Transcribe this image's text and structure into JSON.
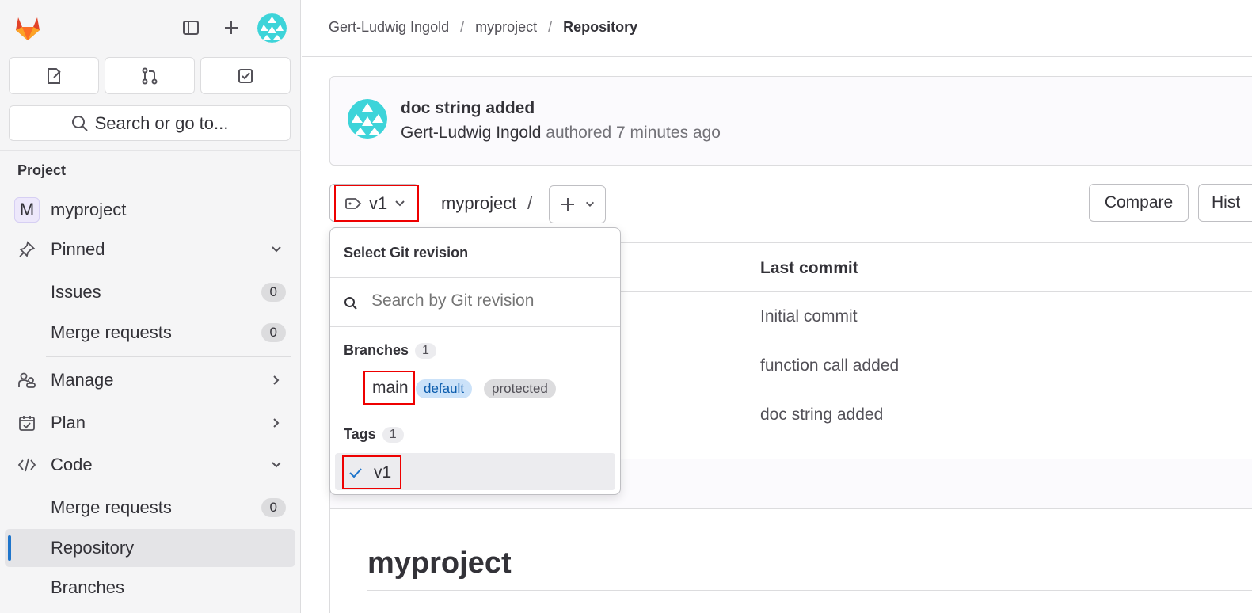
{
  "sidebar": {
    "search_label": "Search or go to...",
    "section_title": "Project",
    "project": {
      "initial": "M",
      "name": "myproject"
    },
    "pinned_label": "Pinned",
    "pinned_items": [
      {
        "label": "Issues",
        "count": "0"
      },
      {
        "label": "Merge requests",
        "count": "0"
      }
    ],
    "manage_label": "Manage",
    "plan_label": "Plan",
    "code_label": "Code",
    "code_items": [
      {
        "label": "Merge requests",
        "count": "0"
      },
      {
        "label": "Repository"
      },
      {
        "label": "Branches"
      }
    ]
  },
  "breadcrumb": [
    "Gert-Ludwig Ingold",
    "myproject",
    "Repository"
  ],
  "commit": {
    "title": "doc string added",
    "author": "Gert-Ludwig Ingold",
    "meta": "authored 7 minutes ago"
  },
  "toolbar": {
    "revision": "v1",
    "path": "myproject",
    "path_sep": "/",
    "compare_label": "Compare",
    "history_label": "Hist"
  },
  "table": {
    "last_commit_header": "Last commit",
    "rows": [
      "Initial commit",
      "function call added",
      "doc string added"
    ]
  },
  "readme": {
    "title": "myproject"
  },
  "dropdown": {
    "title": "Select Git revision",
    "search_placeholder": "Search by Git revision",
    "branches_label": "Branches",
    "branches_count": "1",
    "branch_name": "main",
    "badge_default": "default",
    "badge_protected": "protected",
    "tags_label": "Tags",
    "tags_count": "1",
    "tag_name": "v1"
  },
  "colors": {
    "accent": "#1f75cb",
    "highlight": "#ee0000",
    "sidebar_bg": "#f5f5f6"
  }
}
